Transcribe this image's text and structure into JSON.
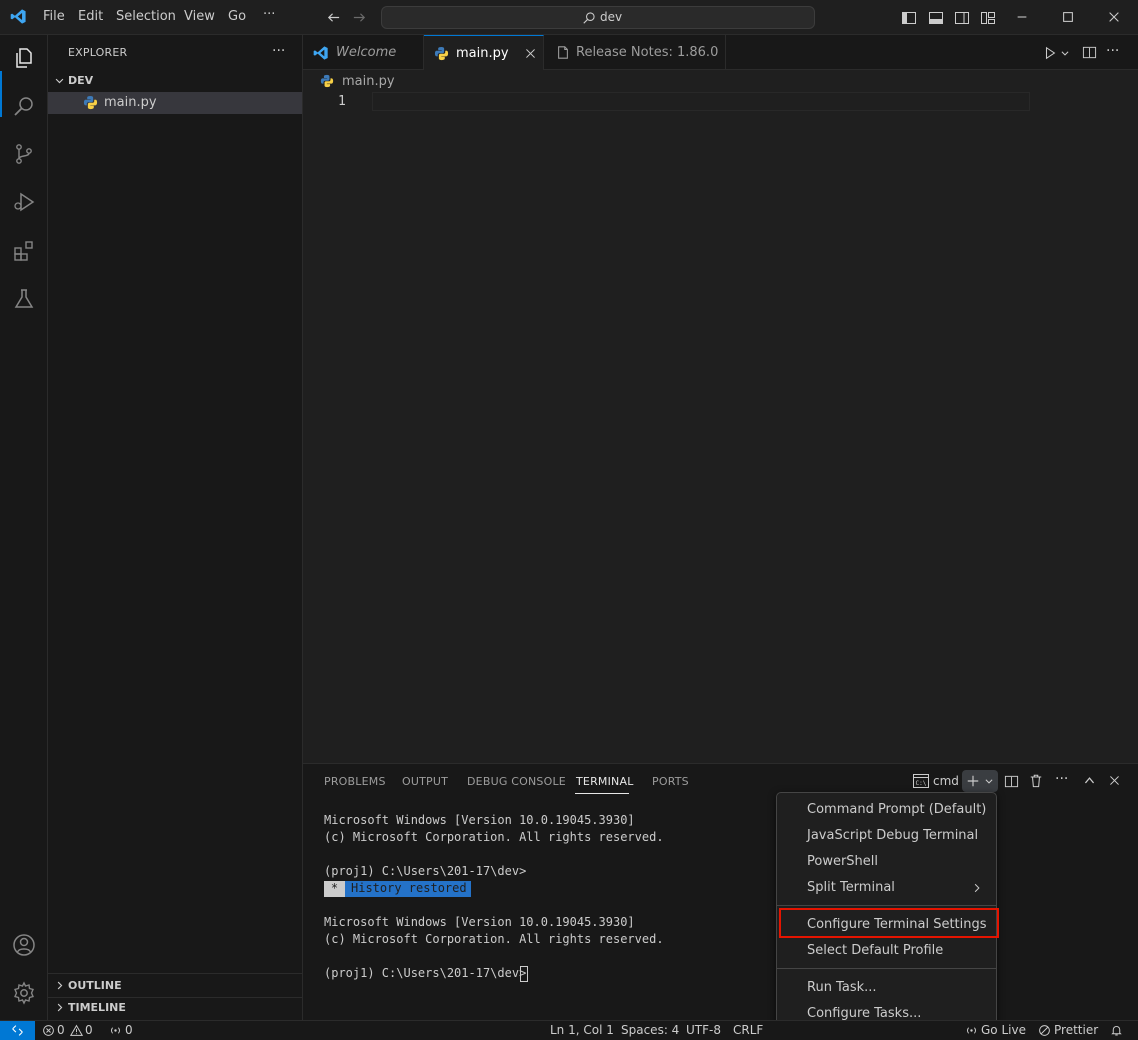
{
  "titlebar": {
    "menus": [
      "File",
      "Edit",
      "Selection",
      "View",
      "Go"
    ],
    "more": "···",
    "search_text": "dev"
  },
  "sidebar": {
    "title": "EXPLORER",
    "more": "···",
    "folder": "DEV",
    "file": "main.py",
    "outline": "OUTLINE",
    "timeline": "TIMELINE"
  },
  "tabs": [
    {
      "label": "Welcome"
    },
    {
      "label": "main.py"
    },
    {
      "label": "Release Notes: 1.86.0"
    }
  ],
  "breadcrumb": "main.py",
  "editor": {
    "line_number": "1"
  },
  "panel": {
    "tabs": [
      "PROBLEMS",
      "OUTPUT",
      "DEBUG CONSOLE",
      "TERMINAL",
      "PORTS"
    ],
    "active_tab": "TERMINAL",
    "terminal_name": "cmd",
    "terminal_lines": [
      "Microsoft Windows [Version 10.0.19045.3930]",
      "(c) Microsoft Corporation. All rights reserved.",
      "",
      "(proj1) C:\\Users\\201-17\\dev>",
      "",
      "",
      "Microsoft Windows [Version 10.0.19045.3930]",
      "(c) Microsoft Corporation. All rights reserved.",
      "",
      "(proj1) C:\\Users\\201-17\\dev>"
    ],
    "history_marker": "*",
    "history_text": "History restored"
  },
  "context_menu": {
    "items": [
      "Command Prompt (Default)",
      "JavaScript Debug Terminal",
      "PowerShell",
      "Split Terminal",
      "Configure Terminal Settings",
      "Select Default Profile",
      "Run Task...",
      "Configure Tasks..."
    ],
    "highlighted": "Configure Terminal Settings"
  },
  "statusbar": {
    "errors": "0",
    "warnings": "0",
    "ports": "0",
    "position": "Ln 1, Col 1",
    "spaces": "Spaces: 4",
    "encoding": "UTF-8",
    "eol": "CRLF",
    "live": "Go Live",
    "prettier": "Prettier"
  },
  "colors": {
    "accent": "#0078d4",
    "highlight_box": "#e51400",
    "history_bg": "#2472c8"
  }
}
